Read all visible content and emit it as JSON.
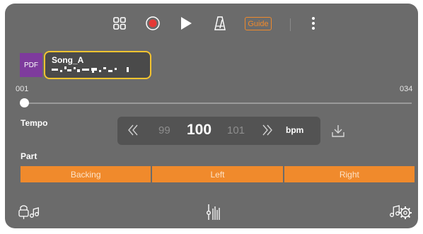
{
  "toolbar": {
    "icons": [
      "grid-icon",
      "record-icon",
      "play-icon",
      "metronome-icon",
      "more-icon"
    ],
    "guide_label": "Guide"
  },
  "song": {
    "pdf_label": "PDF",
    "title": "Song_A"
  },
  "position": {
    "start_bar": "001",
    "end_bar": "034",
    "current_fraction": 0
  },
  "tempo": {
    "label": "Tempo",
    "previous": "99",
    "current": "100",
    "next": "101",
    "unit": "bpm"
  },
  "part": {
    "label": "Part",
    "options": [
      "Backing",
      "Left",
      "Right"
    ]
  },
  "colors": {
    "panel": "#6b6b6b",
    "accent": "#f08a2c",
    "highlight": "#f4c430",
    "pdf": "#7e3b9d",
    "record": "#e53935"
  }
}
